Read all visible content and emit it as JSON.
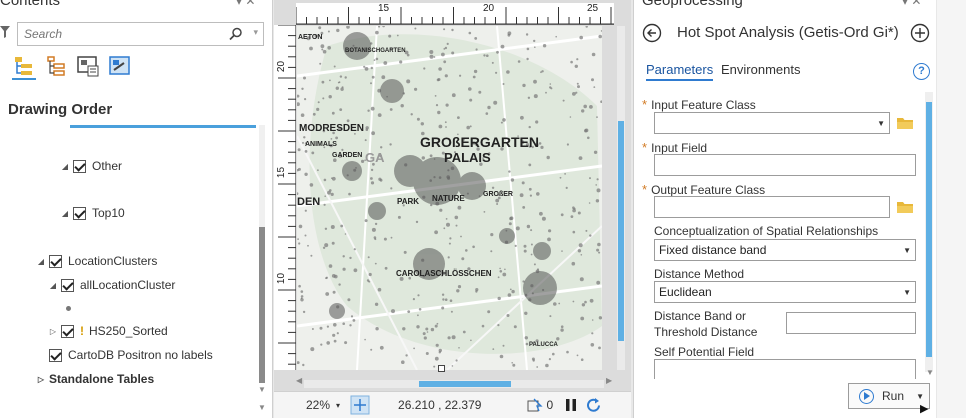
{
  "contents": {
    "title": "Contents",
    "search_placeholder": "Search",
    "drawing_order_label": "Drawing Order",
    "layers": [
      {
        "label": "Other"
      },
      {
        "label": "Top10"
      },
      {
        "label": "LocationClusters"
      },
      {
        "label": "allLocationCluster"
      },
      {
        "label": "HS250_Sorted"
      },
      {
        "label": "CartoDB Positron no labels"
      }
    ],
    "standalone_tables_label": "Standalone Tables",
    "warning_glyph": "!"
  },
  "map": {
    "ruler_top_ticks": [
      "15",
      "20",
      "25"
    ],
    "ruler_left_ticks": [
      "20",
      "15",
      "10"
    ],
    "labels": {
      "grossergarten": "GROßERGARTEN",
      "palais": "PALAIS",
      "modresden": "MODRESDEN",
      "den": "DEN",
      "animals": "ANIMALS",
      "garden": "GARDEN",
      "park": "PARK",
      "nature": "NATURE",
      "grober": "GROßER",
      "carolaschloesschen": "CAROLASCHLÖSSCHEN",
      "botanischgarten": "BOTANISCHGARTEN",
      "palucca": "PALUCCA",
      "aeton": "AETON",
      "ga": "GA"
    },
    "status": {
      "zoom": "22%",
      "coordinates": "26.210 , 22.379",
      "selected_count": "0"
    }
  },
  "geoprocessing": {
    "title": "Geoprocessing",
    "tool_title": "Hot Spot Analysis (Getis-Ord Gi*)",
    "tabs": [
      "Parameters",
      "Environments"
    ],
    "help_glyph": "?",
    "required_marker": "*",
    "params": {
      "input_feature_class": {
        "label": "Input Feature Class",
        "value": ""
      },
      "input_field": {
        "label": "Input Field",
        "value": ""
      },
      "output_feature_class": {
        "label": "Output Feature Class",
        "value": ""
      },
      "conceptualization": {
        "label": "Conceptualization of Spatial Relationships",
        "value": "Fixed distance band"
      },
      "distance_method": {
        "label": "Distance Method",
        "value": "Euclidean"
      },
      "distance_band": {
        "label_line1": "Distance Band or",
        "label_line2": "Threshold Distance",
        "value": ""
      },
      "self_potential_field": {
        "label": "Self Potential Field",
        "value": ""
      }
    },
    "run_label": "Run"
  },
  "colors": {
    "accent_blue": "#2f7bd0",
    "scroll_blue": "#5fb0e4",
    "required_orange": "#d27b25",
    "folder_yellow": "#e8b83a"
  },
  "icons": [
    "filter-icon",
    "search-icon",
    "list-by-drawing-order-icon",
    "list-by-source-icon",
    "list-by-selection-icon",
    "list-by-editing-icon",
    "back-icon",
    "add-icon",
    "help-icon",
    "folder-icon",
    "play-icon",
    "refresh-icon",
    "pause-icon",
    "selection-icon"
  ]
}
